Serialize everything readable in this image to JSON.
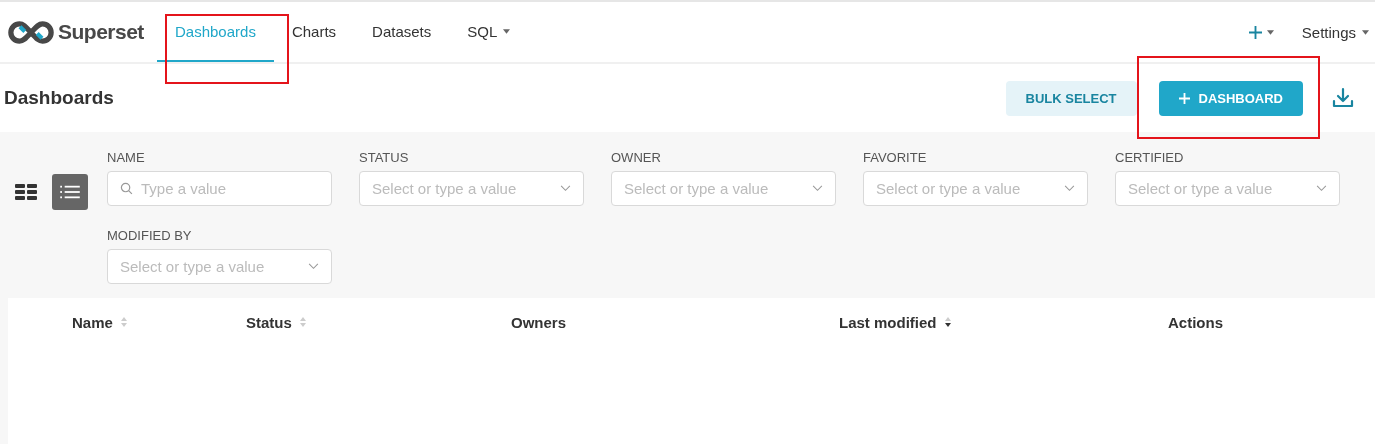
{
  "brand": {
    "name": "Superset"
  },
  "nav": [
    {
      "label": "Dashboards",
      "selected": true,
      "dropdown": false
    },
    {
      "label": "Charts",
      "selected": false,
      "dropdown": false
    },
    {
      "label": "Datasets",
      "selected": false,
      "dropdown": false
    },
    {
      "label": "SQL",
      "selected": false,
      "dropdown": true
    }
  ],
  "right_menu": {
    "settings": "Settings"
  },
  "page": {
    "title": "Dashboards",
    "bulk_select": "BULK SELECT",
    "add_button": "DASHBOARD"
  },
  "view_modes": [
    {
      "kind": "card",
      "selected": false
    },
    {
      "kind": "list",
      "selected": true
    }
  ],
  "filters": [
    {
      "label": "NAME",
      "kind": "search",
      "placeholder": "Type a value"
    },
    {
      "label": "STATUS",
      "kind": "select",
      "placeholder": "Select or type a value"
    },
    {
      "label": "OWNER",
      "kind": "select",
      "placeholder": "Select or type a value"
    },
    {
      "label": "FAVORITE",
      "kind": "select",
      "placeholder": "Select or type a value"
    },
    {
      "label": "CERTIFIED",
      "kind": "select",
      "placeholder": "Select or type a value"
    },
    {
      "label": "MODIFIED BY",
      "kind": "select",
      "placeholder": "Select or type a value"
    }
  ],
  "table": {
    "columns": [
      {
        "label": "Name",
        "sortable": true,
        "sorted": false
      },
      {
        "label": "Status",
        "sortable": true,
        "sorted": false
      },
      {
        "label": "Owners",
        "sortable": false
      },
      {
        "label": "Last modified",
        "sortable": true,
        "sorted": true
      },
      {
        "label": "Actions",
        "sortable": false
      }
    ]
  }
}
